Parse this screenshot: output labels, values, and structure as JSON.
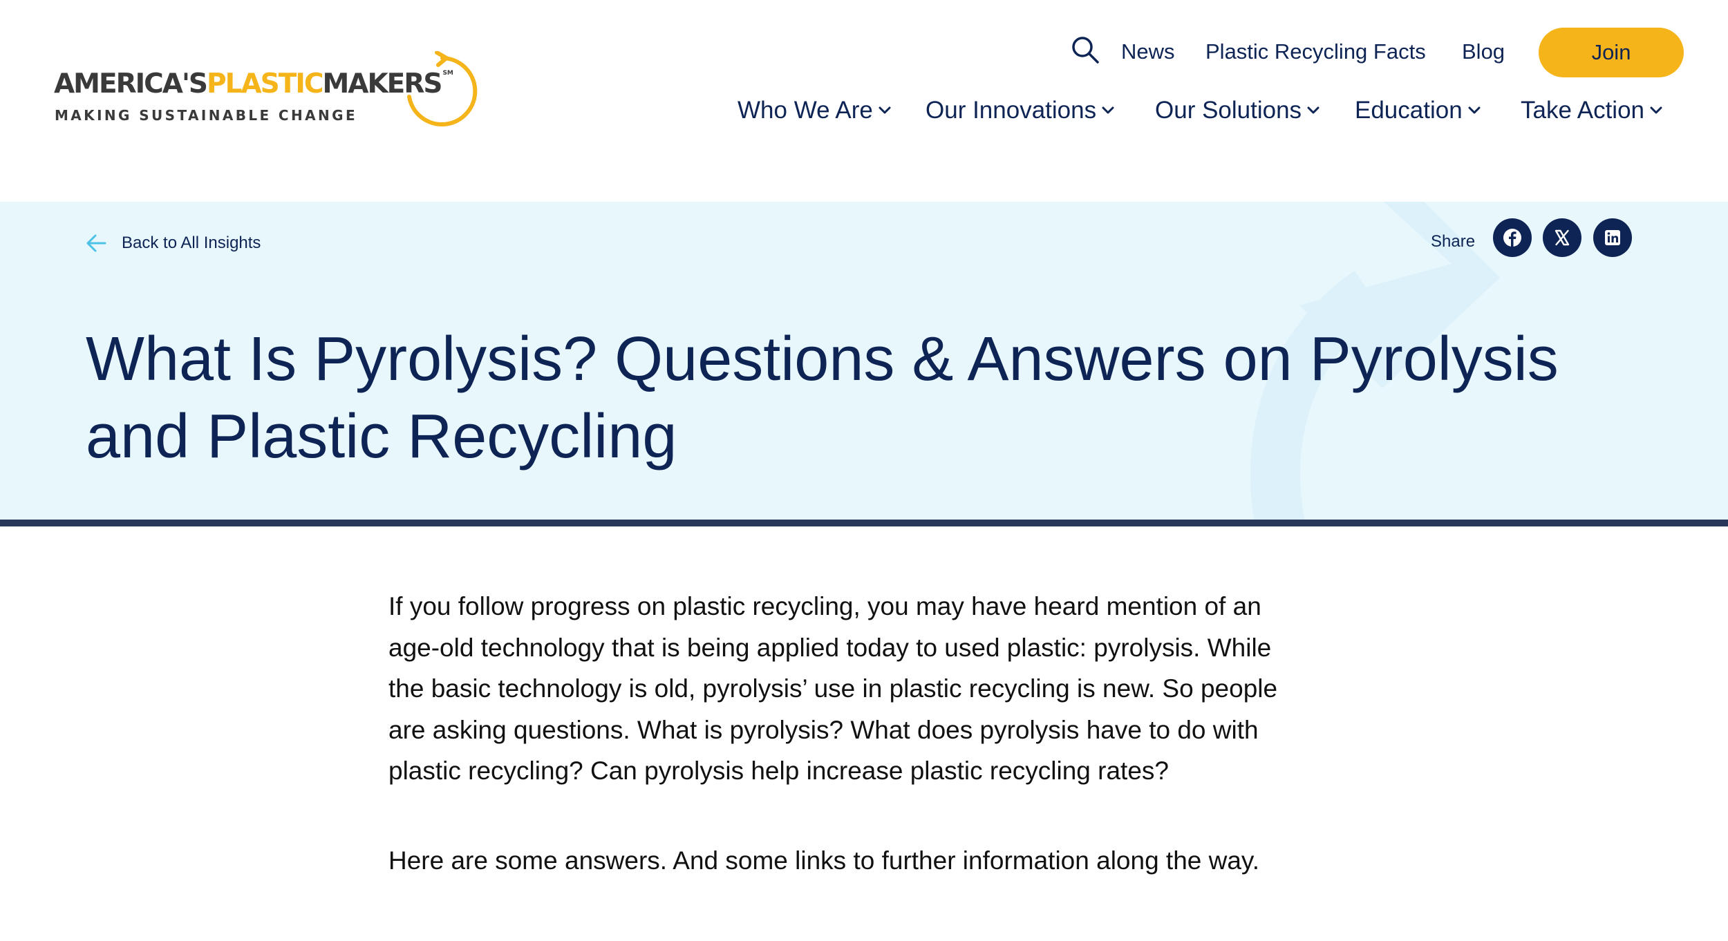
{
  "logo": {
    "word1": "AMERICA'S",
    "word2": "PLASTIC",
    "word3": "MAKERS",
    "mark": "SM",
    "tagline": "MAKING SUSTAINABLE CHANGE"
  },
  "utility_nav": {
    "search_icon": "search-icon",
    "links": [
      "News",
      "Plastic Recycling Facts",
      "Blog"
    ],
    "join_label": "Join"
  },
  "main_nav": [
    "Who We Are",
    "Our Innovations",
    "Our Solutions",
    "Education",
    "Take Action"
  ],
  "hero": {
    "back_label": "Back to All Insights",
    "share_label": "Share",
    "share_icons": [
      "facebook-icon",
      "x-icon",
      "linkedin-icon"
    ],
    "title": "What Is Pyrolysis? Questions & Answers on Pyrolysis and Plastic Recycling"
  },
  "article": {
    "paragraphs": [
      "If you follow progress on plastic recycling, you may have heard mention of an age-old technology that is being applied today to used plastic: pyrolysis. While the basic technology is old, pyrolysis’ use in plastic recycling is new. So people are asking questions. What is pyrolysis? What does pyrolysis have to do with plastic recycling? Can pyrolysis help increase plastic recycling rates?",
      "Here are some answers. And some links to further information along the way."
    ]
  },
  "colors": {
    "navy": "#0d2454",
    "gold": "#f5b41a",
    "hero_bg": "#e8f7fc",
    "rule": "#28375a",
    "accent_arrow": "#4cc3e6"
  }
}
